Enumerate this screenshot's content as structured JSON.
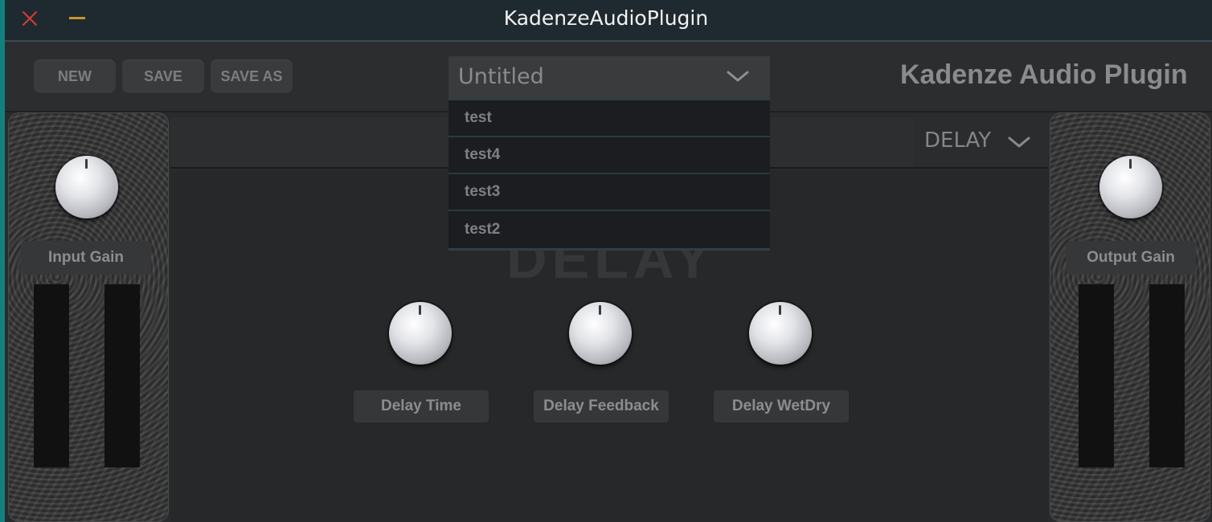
{
  "window": {
    "title": "KadenzeAudioPlugin"
  },
  "toolbar": {
    "new_label": "NEW",
    "save_label": "SAVE",
    "save_as_label": "SAVE AS"
  },
  "preset": {
    "selected": "Untitled",
    "options": [
      "test",
      "test4",
      "test3",
      "test2"
    ]
  },
  "brand": {
    "name": "Kadenze Audio Plugin"
  },
  "fx": {
    "selected": "DELAY",
    "watermark": "DELAY"
  },
  "input": {
    "label": "Input Gain"
  },
  "output": {
    "label": "Output Gain"
  },
  "delay_controls": [
    {
      "label": "Delay Time"
    },
    {
      "label": "Delay Feedback"
    },
    {
      "label": "Delay WetDry"
    }
  ],
  "colors": {
    "close": "#d93a33",
    "minimize": "#c7952e",
    "accent_teal": "#14807d",
    "background": "#2a2b2c"
  }
}
